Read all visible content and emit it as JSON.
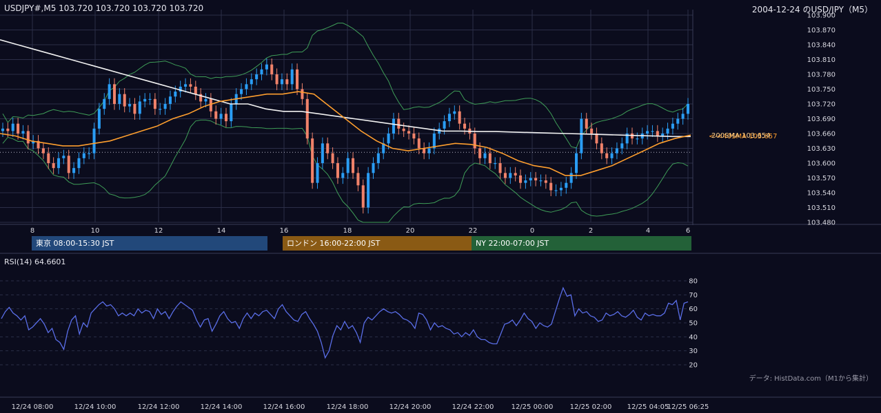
{
  "header": {
    "symbol_info": "USDJPY#,M5 103.720 103.720 103.720 103.720",
    "title": "2004-12-24 のUSD/JPY（M5）"
  },
  "indicators": {
    "sma200_label": "200SMA 103.654",
    "sma_short_label": "<-<40SMA 103.657",
    "rsi_label": "RSI(14) 64.6601",
    "source_note": "データ: HistData.com（M1から集計）"
  },
  "sessions": [
    {
      "label": "東京 08:00-15:30 JST",
      "color": "#22487a"
    },
    {
      "label": "ロンドン 16:00-22:00 JST",
      "color": "#8a5a14"
    },
    {
      "label": "NY 22:00-07:00 JST",
      "color": "#236138"
    }
  ],
  "colors": {
    "background": "#0b0c1d",
    "candle_up": "#2a9df4",
    "candle_down": "#f0826a",
    "sma_long": "#f2f2f2",
    "sma_short": "#ff9f2e",
    "bollinger": "#3f9e58",
    "rsi_line": "#5a6ee8",
    "grid": "#2b2e48"
  },
  "chart_data": [
    {
      "type": "candlestick",
      "title": "2004-12-24 のUSD/JPY（M5）",
      "ylim": [
        103.48,
        103.9
      ],
      "y_ticks": [
        "103.480",
        "103.510",
        "103.540",
        "103.570",
        "103.600",
        "103.630",
        "103.660",
        "103.690",
        "103.720",
        "103.750",
        "103.780",
        "103.810",
        "103.840",
        "103.870",
        "103.900"
      ],
      "x_ticks": [
        "8",
        "10",
        "12",
        "14",
        "16",
        "18",
        "20",
        "22",
        "0",
        "2",
        "4",
        "6"
      ],
      "close_series": [
        103.67,
        103.665,
        103.68,
        103.66,
        103.665,
        103.64,
        103.645,
        103.63,
        103.62,
        103.6,
        103.59,
        103.61,
        103.615,
        103.58,
        103.59,
        103.61,
        103.62,
        103.62,
        103.67,
        103.71,
        103.73,
        103.76,
        103.72,
        103.74,
        103.715,
        103.72,
        103.7,
        103.725,
        103.73,
        103.73,
        103.71,
        103.71,
        103.72,
        103.735,
        103.745,
        103.755,
        103.76,
        103.755,
        103.74,
        103.725,
        103.73,
        103.705,
        103.69,
        103.7,
        103.685,
        103.72,
        103.74,
        103.75,
        103.76,
        103.77,
        103.78,
        103.79,
        103.8,
        103.78,
        103.76,
        103.77,
        103.76,
        103.79,
        103.75,
        103.73,
        103.65,
        103.56,
        103.6,
        103.64,
        103.62,
        103.6,
        103.57,
        103.58,
        103.61,
        103.58,
        103.555,
        103.51,
        103.58,
        103.6,
        103.62,
        103.64,
        103.66,
        103.69,
        103.67,
        103.665,
        103.66,
        103.65,
        103.63,
        103.62,
        103.63,
        103.66,
        103.67,
        103.685,
        103.7,
        103.705,
        103.68,
        103.67,
        103.66,
        103.63,
        103.61,
        103.62,
        103.6,
        103.6,
        103.58,
        103.57,
        103.58,
        103.575,
        103.56,
        103.565,
        103.57,
        103.565,
        103.565,
        103.56,
        103.545,
        103.545,
        103.55,
        103.56,
        103.58,
        103.62,
        103.69,
        103.67,
        103.66,
        103.64,
        103.62,
        103.61,
        103.62,
        103.63,
        103.64,
        103.66,
        103.65,
        103.65,
        103.66,
        103.665,
        103.665,
        103.655,
        103.66,
        103.67,
        103.68,
        103.69,
        103.7,
        103.72
      ],
      "sma200": [
        103.85,
        103.84,
        103.83,
        103.82,
        103.81,
        103.8,
        103.79,
        103.78,
        103.77,
        103.76,
        103.75,
        103.74,
        103.73,
        103.72,
        103.72,
        103.71,
        103.705,
        103.705,
        103.7,
        103.695,
        103.69,
        103.685,
        103.68,
        103.675,
        103.67,
        103.665,
        103.665,
        103.664,
        103.664,
        103.663,
        103.662,
        103.661,
        103.66,
        103.659,
        103.658,
        103.657,
        103.656,
        103.655,
        103.654,
        103.654
      ],
      "sma40": [
        103.66,
        103.655,
        103.645,
        103.64,
        103.635,
        103.635,
        103.64,
        103.645,
        103.655,
        103.665,
        103.675,
        103.69,
        103.7,
        103.715,
        103.725,
        103.73,
        103.735,
        103.74,
        103.74,
        103.745,
        103.74,
        103.715,
        103.69,
        103.665,
        103.645,
        103.63,
        103.625,
        103.63,
        103.635,
        103.64,
        103.638,
        103.632,
        103.62,
        103.605,
        103.595,
        103.59,
        103.575,
        103.575,
        103.585,
        103.595,
        103.61,
        103.625,
        103.64,
        103.65,
        103.657
      ]
    },
    {
      "type": "line",
      "title": "RSI(14) 64.6601",
      "ylim": [
        20,
        80
      ],
      "y_ticks": [
        "20",
        "30",
        "40",
        "50",
        "60",
        "70",
        "80"
      ],
      "x_ticks": [
        "12/24 08:00",
        "12/24 10:00",
        "12/24 12:00",
        "12/24 14:00",
        "12/24 16:00",
        "12/24 18:00",
        "12/24 20:00",
        "12/24 22:00",
        "12/25 00:00",
        "12/25 02:00",
        "12/25 04:05",
        "12/25 06:25"
      ],
      "series": [
        {
          "name": "RSI(14)",
          "values": [
            53,
            58,
            61,
            57,
            55,
            52,
            55,
            45,
            47,
            50,
            53,
            49,
            43,
            46,
            38,
            36,
            31,
            44,
            52,
            55,
            42,
            50,
            47,
            57,
            60,
            63,
            65,
            62,
            63,
            60,
            55,
            57,
            55,
            57,
            55,
            60,
            57,
            59,
            58,
            53,
            60,
            56,
            58,
            53,
            58,
            62,
            65,
            63,
            61,
            59,
            52,
            47,
            52,
            53,
            44,
            49,
            55,
            58,
            53,
            50,
            51,
            46,
            53,
            57,
            53,
            57,
            55,
            58,
            59,
            56,
            53,
            60,
            63,
            58,
            55,
            52,
            51,
            56,
            58,
            53,
            49,
            44,
            36,
            25,
            30,
            41,
            48,
            45,
            51,
            46,
            48,
            43,
            36,
            50,
            54,
            52,
            55,
            58,
            60,
            58,
            57,
            58,
            56,
            53,
            52,
            50,
            46,
            57,
            56,
            52,
            45,
            50,
            47,
            48,
            46,
            45,
            42,
            43,
            40,
            43,
            41,
            45,
            40,
            38,
            38,
            36,
            35,
            35,
            42,
            49,
            50,
            52,
            48,
            52,
            57,
            53,
            51,
            46,
            50,
            48,
            47,
            49,
            58,
            67,
            75,
            69,
            70,
            55,
            60,
            57,
            58,
            55,
            54,
            51,
            52,
            57,
            55,
            56,
            58,
            55,
            54,
            56,
            59,
            54,
            52,
            57,
            55,
            56,
            55,
            55,
            57,
            64,
            63,
            66,
            52,
            64,
            65
          ]
        }
      ]
    }
  ]
}
